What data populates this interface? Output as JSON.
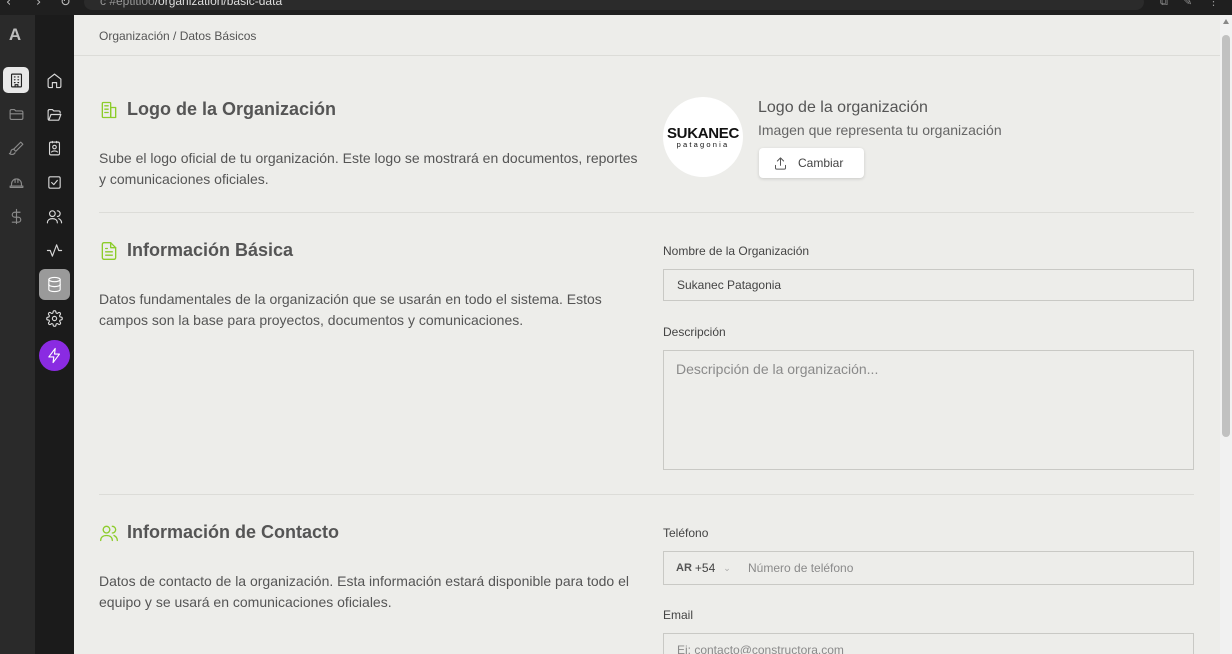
{
  "browser": {
    "url_dim": "c  #eptitloo",
    "url_path": "/organization/basic-data"
  },
  "sidebar": {
    "logo_letter": "A",
    "rail1_icons": [
      "building-icon",
      "folder-icon",
      "brush-icon",
      "hardhat-icon",
      "dollar-icon"
    ],
    "rail2_icons": [
      "home-icon",
      "folder-open-icon",
      "contact-card-icon",
      "checkbox-icon",
      "users-icon",
      "activity-icon",
      "database-icon",
      "gear-icon",
      "lightning-icon"
    ],
    "active_rail2": "database-icon"
  },
  "breadcrumb": "Organización / Datos Básicos",
  "logo_section": {
    "title": "Logo de la Organización",
    "description": "Sube el logo oficial de tu organización. Este logo se mostrará en documentos, reportes y comunicaciones oficiales.",
    "logo_brand": "SUKANEC",
    "logo_sub": "patagonia",
    "label": "Logo de la organización",
    "sublabel": "Imagen que representa tu organización",
    "change_button": "Cambiar"
  },
  "basic_section": {
    "title": "Información Básica",
    "description": "Datos fundamentales de la organización que se usarán en todo el sistema. Estos campos son la base para proyectos, documentos y comunicaciones.",
    "name_label": "Nombre de la Organización",
    "name_value": "Sukanec Patagonia",
    "desc_label": "Descripción",
    "desc_placeholder": "Descripción de la organización..."
  },
  "contact_section": {
    "title": "Información de Contacto",
    "description": "Datos de contacto de la organización. Esta información estará disponible para todo el equipo y se usará en comunicaciones oficiales.",
    "phone_label": "Teléfono",
    "country_code": "AR",
    "dial_code": "+54",
    "phone_placeholder": "Número de teléfono",
    "email_label": "Email",
    "email_placeholder": "Ej: contacto@constructora.com"
  },
  "colors": {
    "accent_green": "#8ccc2a",
    "power_purple": "#8a2be2"
  }
}
